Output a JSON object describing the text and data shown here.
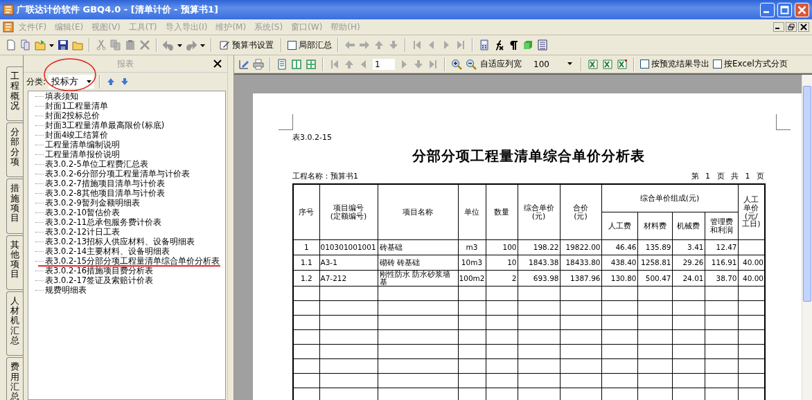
{
  "window": {
    "title": "广联达计价软件 GBQ4.0 - [清单计价 - 预算书1]"
  },
  "menu": [
    "文件(F)",
    "编辑(E)",
    "视图(V)",
    "工具(T)",
    "导入导出(I)",
    "维护(M)",
    "系统(S)",
    "窗口(W)",
    "帮助(H)"
  ],
  "toolbar": {
    "settings_button": "预算书设置",
    "partial_summary": {
      "label": "局部汇总",
      "checked": false
    }
  },
  "side_tabs": [
    {
      "label": "工程概况",
      "selected": false
    },
    {
      "label": "分部分项",
      "selected": false
    },
    {
      "label": "措施项目",
      "selected": false
    },
    {
      "label": "其他项目",
      "selected": false
    },
    {
      "label": "人材机汇总",
      "selected": false
    },
    {
      "label": "费用汇总",
      "selected": false
    }
  ],
  "report_panel": {
    "title": "报表",
    "category_label": "分类:",
    "category_value": "投标方",
    "items": [
      "填表须知",
      "封面1工程量清单",
      "封面2投标总价",
      "封面3工程量清单最高限价(标底)",
      "封面4竣工结算价",
      "工程量清单编制说明",
      "工程量清单报价说明",
      "表3.0.2-5单位工程费汇总表",
      "表3.0.2-6分部分项工程量清单与计价表",
      "表3.0.2-7措施项目清单与计价表",
      "表3.0.2-8其他项目清单与计价表",
      "表3.0.2-9暂列金额明细表",
      "表3.0.2-10暂估价表",
      "表3.0.2-11总承包服务费计价表",
      "表3.0.2-12计日工表",
      "表3.0.2-13招标人供应材料、设备明细表",
      "表3.0.2-14主要材料、设备明细表",
      "表3.0.2-15分部分项工程量清单综合单价分析表",
      "表3.0.2-16措施项目费分析表",
      "表3.0.2-17签证及索赔计价表",
      "规费明细表"
    ]
  },
  "preview_toolbar": {
    "page": "1",
    "fit_label": "自适应列宽",
    "zoom": "100",
    "export_by_preview": {
      "label": "按预览结果导出",
      "checked": false
    },
    "excel_paging": {
      "label": "按Excel方式分页",
      "checked": false
    }
  },
  "report": {
    "table_no": "表3.0.2-15",
    "title": "分部分项工程量清单综合单价分析表",
    "project": "工程名称：预算书1",
    "page_info": "第 1 页 共 1 页",
    "header": [
      {
        "lines": [
          "序号"
        ]
      },
      {
        "lines": [
          "项目编号",
          "(定额编号)"
        ]
      },
      {
        "lines": [
          "项目名称"
        ]
      },
      {
        "lines": [
          "单位"
        ]
      },
      {
        "lines": [
          "数量"
        ]
      },
      {
        "lines": [
          "综合单价",
          "(元)"
        ]
      },
      {
        "lines": [
          "合价",
          "(元)"
        ]
      },
      {
        "lines": [
          "综合单价组成(元)"
        ],
        "children": [
          {
            "lines": [
              "人工费"
            ]
          },
          {
            "lines": [
              "材料费"
            ]
          },
          {
            "lines": [
              "机械费"
            ]
          },
          {
            "lines": [
              "管理费",
              "和利润"
            ]
          }
        ]
      },
      {
        "lines": [
          "人工",
          "单价",
          "(元/",
          "工日)"
        ]
      }
    ],
    "rows": [
      [
        "1",
        "010301001001",
        "砖基础",
        "m3",
        "100",
        "198.22",
        "19822.00",
        "46.46",
        "135.89",
        "3.41",
        "12.47"
      ],
      [
        "1.1",
        "A3-1",
        "砌砖 砖基础",
        "10m3",
        "10",
        "1843.38",
        "18433.80",
        "438.40",
        "1258.81",
        "29.26",
        "116.91",
        "40.00"
      ],
      [
        "1.2",
        "A7-212",
        "刚性防水 防水砂浆墙基",
        "100m2",
        "2",
        "693.98",
        "1387.96",
        "130.80",
        "500.47",
        "24.01",
        "38.70",
        "40.00"
      ]
    ]
  }
}
